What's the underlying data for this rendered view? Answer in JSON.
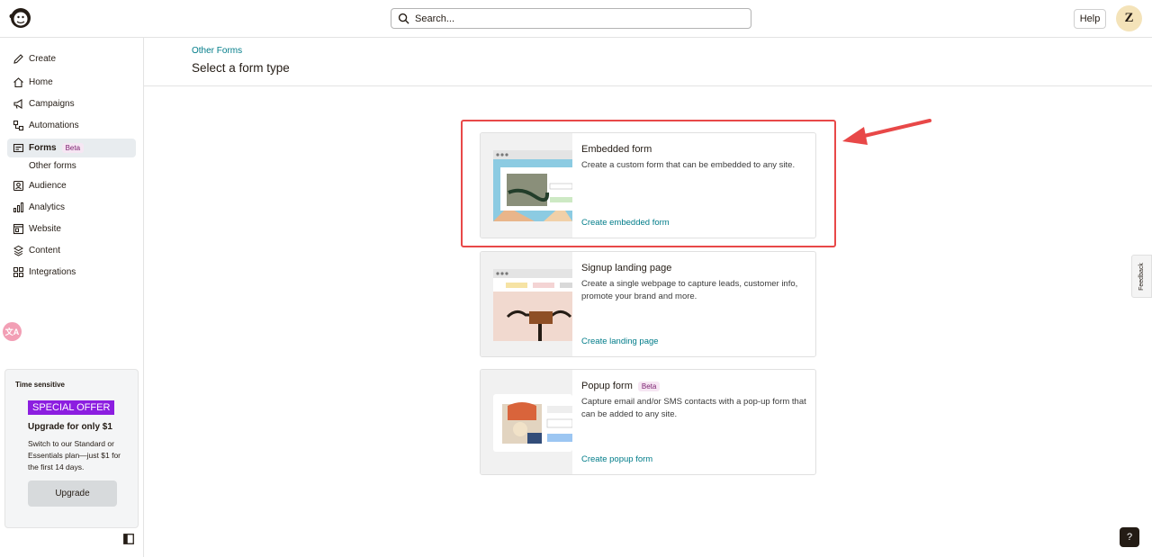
{
  "header": {
    "search_placeholder": "Search...",
    "help_label": "Help",
    "avatar_initial": "Z"
  },
  "sidebar": {
    "items": [
      {
        "label": "Create",
        "icon": "pencil-icon"
      },
      {
        "label": "Home",
        "icon": "home-icon"
      },
      {
        "label": "Campaigns",
        "icon": "megaphone-icon"
      },
      {
        "label": "Automations",
        "icon": "automation-icon"
      },
      {
        "label": "Forms",
        "icon": "forms-icon",
        "badge": "Beta",
        "active": true
      },
      {
        "label": "Audience",
        "icon": "audience-icon"
      },
      {
        "label": "Analytics",
        "icon": "bar-chart-icon"
      },
      {
        "label": "Website",
        "icon": "website-icon"
      },
      {
        "label": "Content",
        "icon": "content-icon"
      },
      {
        "label": "Integrations",
        "icon": "grid-icon"
      }
    ],
    "sub_item": "Other forms"
  },
  "promo": {
    "time_sensitive": "Time sensitive",
    "offer": "SPECIAL OFFER",
    "title": "Upgrade for only $1",
    "description": "Switch to our Standard or Essentials plan—just $1 for the first 14 days.",
    "button": "Upgrade"
  },
  "main": {
    "breadcrumb": "Other Forms",
    "title": "Select a form type",
    "cards": [
      {
        "title": "Embedded form",
        "description": "Create a custom form that can be embedded to any site.",
        "link": "Create embedded form"
      },
      {
        "title": "Signup landing page",
        "description": "Create a single webpage to capture leads, customer info, promote your brand and more.",
        "link": "Create landing page"
      },
      {
        "title": "Popup form",
        "badge": "Beta",
        "description": "Capture email and/or SMS contacts with a pop-up form that can be added to any site.",
        "link": "Create popup form"
      }
    ]
  },
  "feedback_label": "Feedback",
  "help_question": "?",
  "colors": {
    "accent": "#007c89",
    "highlight": "#e84848",
    "offer": "#8c1ee0"
  }
}
